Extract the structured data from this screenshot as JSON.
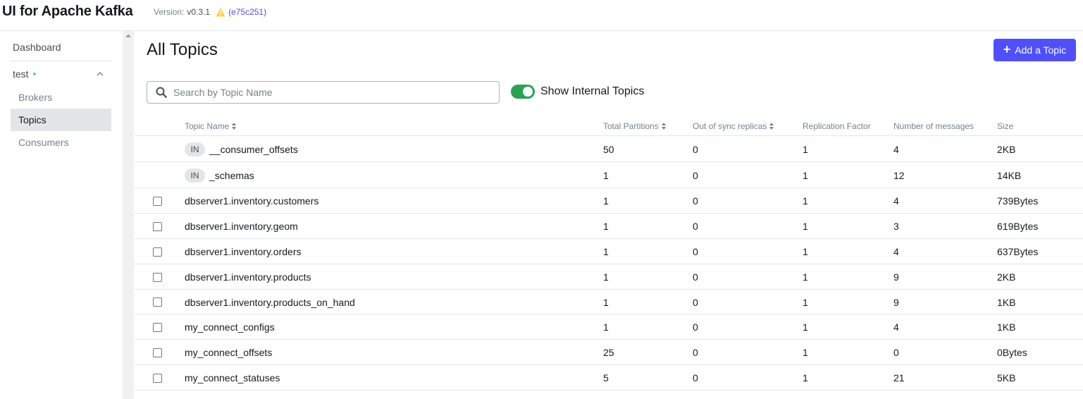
{
  "app": {
    "title": "UI for Apache Kafka",
    "version_label": "Version:",
    "version": "v0.3.1",
    "commit": "(e75c251)"
  },
  "sidebar": {
    "dashboard": "Dashboard",
    "cluster": "test",
    "items": [
      "Brokers",
      "Topics",
      "Consumers"
    ]
  },
  "main": {
    "title": "All Topics",
    "add_button": "Add a Topic",
    "search_placeholder": "Search by Topic Name",
    "toggle_label": "Show Internal Topics",
    "toggle_on": true
  },
  "table": {
    "headers": [
      "Topic Name",
      "Total Partitions",
      "Out of sync replicas",
      "Replication Factor",
      "Number of messages",
      "Size"
    ],
    "rows": [
      {
        "internal": true,
        "badge": "IN",
        "name": "__consumer_offsets",
        "partitions": "50",
        "out_of_sync": "0",
        "replication": "1",
        "messages": "4",
        "size": "2KB"
      },
      {
        "internal": true,
        "badge": "IN",
        "name": "_schemas",
        "partitions": "1",
        "out_of_sync": "0",
        "replication": "1",
        "messages": "12",
        "size": "14KB"
      },
      {
        "internal": false,
        "name": "dbserver1.inventory.customers",
        "partitions": "1",
        "out_of_sync": "0",
        "replication": "1",
        "messages": "4",
        "size": "739Bytes"
      },
      {
        "internal": false,
        "name": "dbserver1.inventory.geom",
        "partitions": "1",
        "out_of_sync": "0",
        "replication": "1",
        "messages": "3",
        "size": "619Bytes"
      },
      {
        "internal": false,
        "name": "dbserver1.inventory.orders",
        "partitions": "1",
        "out_of_sync": "0",
        "replication": "1",
        "messages": "4",
        "size": "637Bytes"
      },
      {
        "internal": false,
        "name": "dbserver1.inventory.products",
        "partitions": "1",
        "out_of_sync": "0",
        "replication": "1",
        "messages": "9",
        "size": "2KB"
      },
      {
        "internal": false,
        "name": "dbserver1.inventory.products_on_hand",
        "partitions": "1",
        "out_of_sync": "0",
        "replication": "1",
        "messages": "9",
        "size": "1KB"
      },
      {
        "internal": false,
        "name": "my_connect_configs",
        "partitions": "1",
        "out_of_sync": "0",
        "replication": "1",
        "messages": "4",
        "size": "1KB"
      },
      {
        "internal": false,
        "name": "my_connect_offsets",
        "partitions": "25",
        "out_of_sync": "0",
        "replication": "1",
        "messages": "0",
        "size": "0Bytes"
      },
      {
        "internal": false,
        "name": "my_connect_statuses",
        "partitions": "5",
        "out_of_sync": "0",
        "replication": "1",
        "messages": "21",
        "size": "5KB"
      }
    ]
  },
  "colors": {
    "accent": "#4f4ffe",
    "toggle_on": "#29a352",
    "online_dot": "#5cd685",
    "warning": "#ffd439"
  }
}
